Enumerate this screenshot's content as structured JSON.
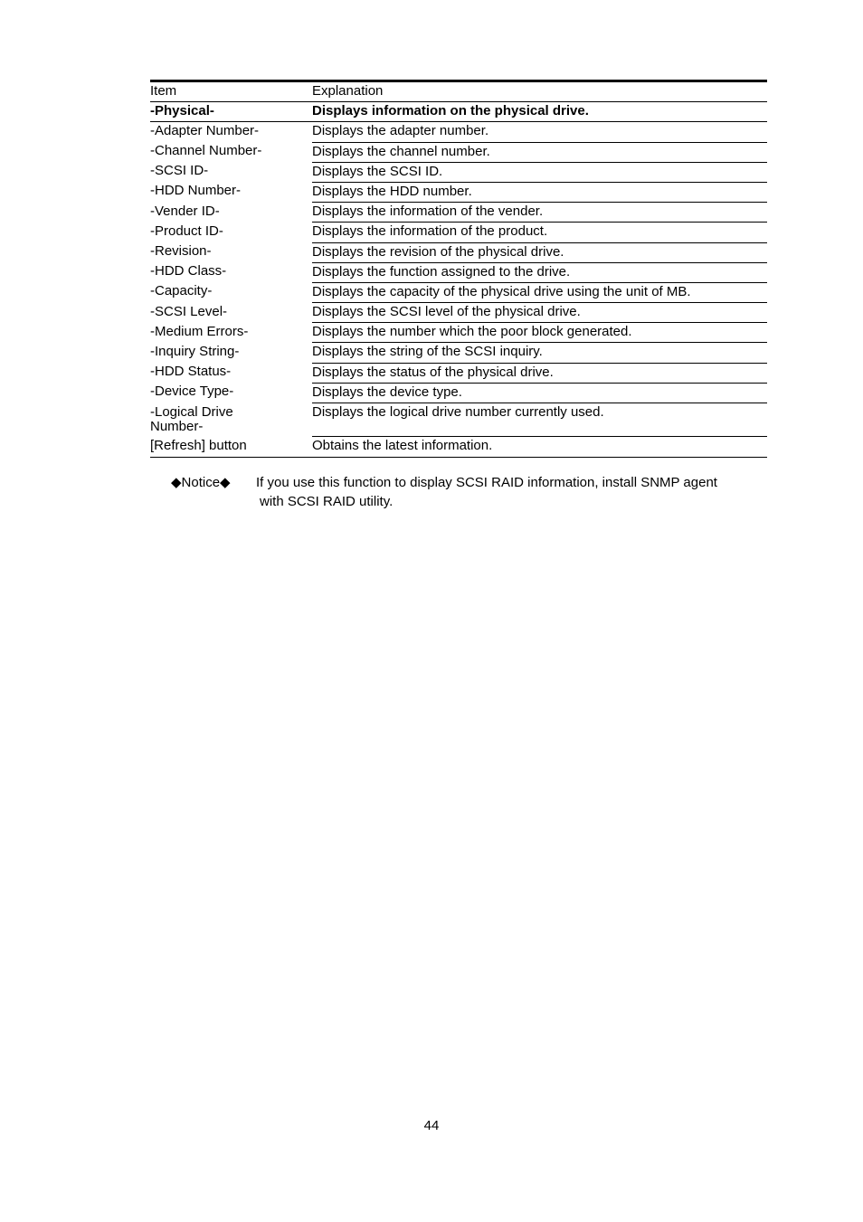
{
  "table": {
    "columns": [
      "Item",
      "Explanation"
    ],
    "rows": [
      {
        "item": "Item",
        "explanation": "Explanation",
        "bold": false,
        "rule": "full"
      },
      {
        "item": "-Physical-",
        "explanation": "Displays information on the physical drive.",
        "bold": true,
        "rule": "full"
      },
      {
        "item": "-Adapter Number-",
        "explanation": "Displays the adapter number.",
        "bold": false,
        "rule": "half"
      },
      {
        "item": "-Channel Number-",
        "explanation": "Displays the channel number.",
        "bold": false,
        "rule": "half"
      },
      {
        "item": "-SCSI ID-",
        "explanation": "Displays the SCSI ID.",
        "bold": false,
        "rule": "half"
      },
      {
        "item": "-HDD Number-",
        "explanation": "Displays the HDD number.",
        "bold": false,
        "rule": "half"
      },
      {
        "item": "-Vender ID-",
        "explanation": "Displays the information of the vender.",
        "bold": false,
        "rule": "half"
      },
      {
        "item": "-Product ID-",
        "explanation": "Displays the information of the product.",
        "bold": false,
        "rule": "half"
      },
      {
        "item": "-Revision-",
        "explanation": "Displays the revision of the physical drive.",
        "bold": false,
        "rule": "half"
      },
      {
        "item": "-HDD Class-",
        "explanation": "Displays the function assigned to the drive.",
        "bold": false,
        "rule": "half"
      },
      {
        "item": "-Capacity-",
        "explanation": "Displays the capacity of the physical drive using the unit of MB.",
        "bold": false,
        "rule": "half"
      },
      {
        "item": "-SCSI Level-",
        "explanation": "Displays the SCSI level of the physical drive.",
        "bold": false,
        "rule": "half"
      },
      {
        "item": "-Medium Errors-",
        "explanation": "Displays the number which the poor block generated.",
        "bold": false,
        "rule": "half"
      },
      {
        "item": "-Inquiry String-",
        "explanation": "Displays the string of the SCSI inquiry.",
        "bold": false,
        "rule": "half"
      },
      {
        "item": "-HDD Status-",
        "explanation": "Displays the status of the physical drive.",
        "bold": false,
        "rule": "half"
      },
      {
        "item": "-Device Type-",
        "explanation": "Displays the device type.",
        "bold": false,
        "rule": "half"
      },
      {
        "item": "-Logical Drive\nNumber-",
        "explanation": "Displays the logical drive number currently used.",
        "bold": false,
        "rule": "half"
      },
      {
        "item": "[Refresh] button",
        "explanation": "Obtains the latest information.",
        "bold": false,
        "rule": "full"
      }
    ]
  },
  "notice": {
    "label": "◆Notice◆",
    "line1": "If you use this function to display SCSI RAID information, install SNMP agent",
    "line2": "with SCSI RAID utility."
  },
  "footer": {
    "page_number": "44"
  }
}
